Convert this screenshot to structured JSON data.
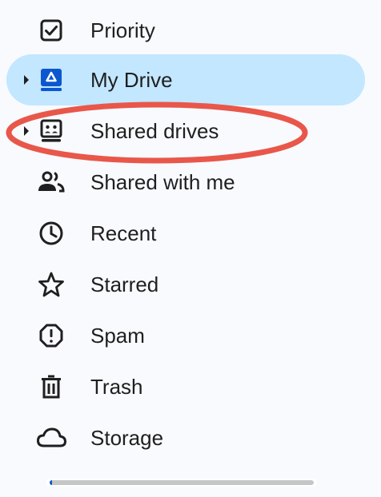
{
  "nav": {
    "items": [
      {
        "label": "Priority",
        "icon": "priority-icon"
      },
      {
        "label": "My Drive",
        "icon": "my-drive-icon",
        "active": true,
        "expandable": true
      },
      {
        "label": "Shared drives",
        "icon": "shared-drives-icon",
        "expandable": true
      },
      {
        "label": "Shared with me",
        "icon": "people-icon"
      },
      {
        "label": "Recent",
        "icon": "clock-icon"
      },
      {
        "label": "Starred",
        "icon": "star-icon"
      },
      {
        "label": "Spam",
        "icon": "spam-icon"
      },
      {
        "label": "Trash",
        "icon": "trash-icon"
      },
      {
        "label": "Storage",
        "icon": "cloud-icon"
      }
    ]
  },
  "storage": {
    "used_fraction": 0.01
  },
  "colors": {
    "active_background": "#c2e7ff",
    "highlight_ellipse": "#e8574a",
    "storage_fill": "#0b57d0",
    "text": "#1f1f1f"
  }
}
